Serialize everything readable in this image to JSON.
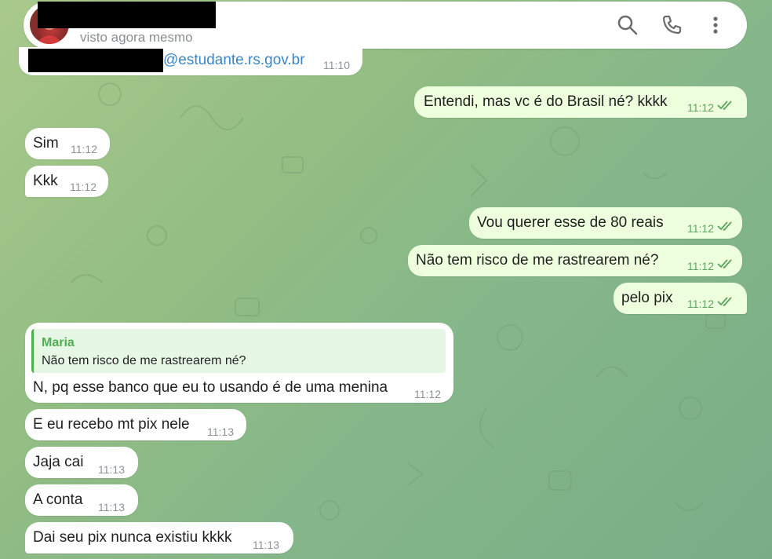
{
  "header": {
    "status": "visto agora mesmo",
    "search_icon": "search-icon",
    "call_icon": "phone-icon",
    "menu_icon": "more-vertical-icon"
  },
  "messages": [
    {
      "dir": "in",
      "text": "@estudante.rs.gov.br",
      "time": "11:10"
    },
    {
      "dir": "out",
      "text": "Entendi, mas vc é do Brasil né? kkkk",
      "time": "11:12"
    },
    {
      "dir": "in",
      "text": "Sim",
      "time": "11:12"
    },
    {
      "dir": "in",
      "text": "Kkk",
      "time": "11:12"
    },
    {
      "dir": "out",
      "text": "Vou querer esse de 80 reais",
      "time": "11:12"
    },
    {
      "dir": "out",
      "text": "Não tem risco de me rastrearem né?",
      "time": "11:12"
    },
    {
      "dir": "out",
      "text": "pelo pix",
      "time": "11:12"
    },
    {
      "dir": "in",
      "reply_name": "Maria",
      "reply_text": "Não tem risco de me rastrearem né?",
      "text": "N, pq esse banco que eu to usando é de uma menina",
      "time": "11:12"
    },
    {
      "dir": "in",
      "text": "E eu recebo mt pix nele",
      "time": "11:13"
    },
    {
      "dir": "in",
      "text": "Jaja cai",
      "time": "11:13"
    },
    {
      "dir": "in",
      "text": "A conta",
      "time": "11:13"
    },
    {
      "dir": "in",
      "text": "Dai seu pix nunca existiu kkkk",
      "time": "11:13"
    }
  ],
  "colors": {
    "incoming_bubble": "#ffffff",
    "outgoing_bubble": "#eeffde",
    "read_checks": "#5ea35d",
    "link": "#3a86c8",
    "reply_accent": "#4fae4e"
  }
}
